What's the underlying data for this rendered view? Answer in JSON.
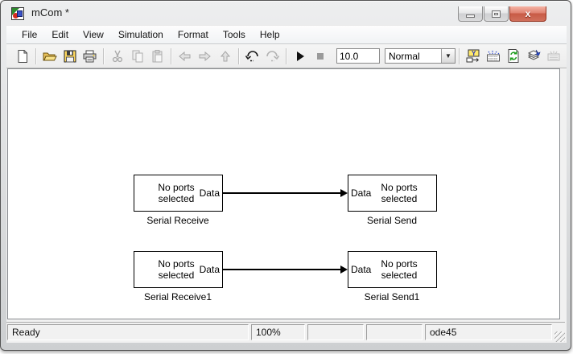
{
  "window": {
    "title": "mCom *",
    "controls": {
      "minimize": "minimize",
      "maximize": "maximize",
      "close": "close"
    }
  },
  "menu": {
    "items": [
      "File",
      "Edit",
      "View",
      "Simulation",
      "Format",
      "Tools",
      "Help"
    ]
  },
  "toolbar": {
    "sim_time": "10.0",
    "mode": "Normal",
    "mode_dropdown_glyph": "▼",
    "icons": [
      "new-icon",
      "open-icon",
      "save-icon",
      "print-icon",
      "cut-icon",
      "copy-icon",
      "paste-icon",
      "back-icon",
      "forward-icon",
      "up-icon",
      "undo-icon",
      "redo-icon",
      "play-icon",
      "stop-icon",
      "model-browser-icon",
      "library-browser-icon",
      "update-diagram-icon",
      "build-icon",
      "target-disabled-icon",
      "debug-icon"
    ],
    "colors": {
      "enabled": "#111111",
      "disabled": "#ABABAB",
      "accent_yellow": "#FFE96B",
      "accent_green": "#1E9E1E",
      "accent_blue": "#2244CC"
    }
  },
  "canvas": {
    "blocks": [
      {
        "label": "Serial Receive",
        "body_line1": "No ports",
        "body_line2": "selected",
        "port": "Data",
        "port_side": "right"
      },
      {
        "label": "Serial Send",
        "body_line1": "No ports",
        "body_line2": "selected",
        "port": "Data",
        "port_side": "left"
      },
      {
        "label": "Serial Receive1",
        "body_line1": "No ports",
        "body_line2": "selected",
        "port": "Data",
        "port_side": "right"
      },
      {
        "label": "Serial Send1",
        "body_line1": "No ports",
        "body_line2": "selected",
        "port": "Data",
        "port_side": "left"
      }
    ]
  },
  "statusbar": {
    "status": "Ready",
    "zoom": "100%",
    "cell3": "",
    "cell4": "",
    "solver": "ode45"
  }
}
